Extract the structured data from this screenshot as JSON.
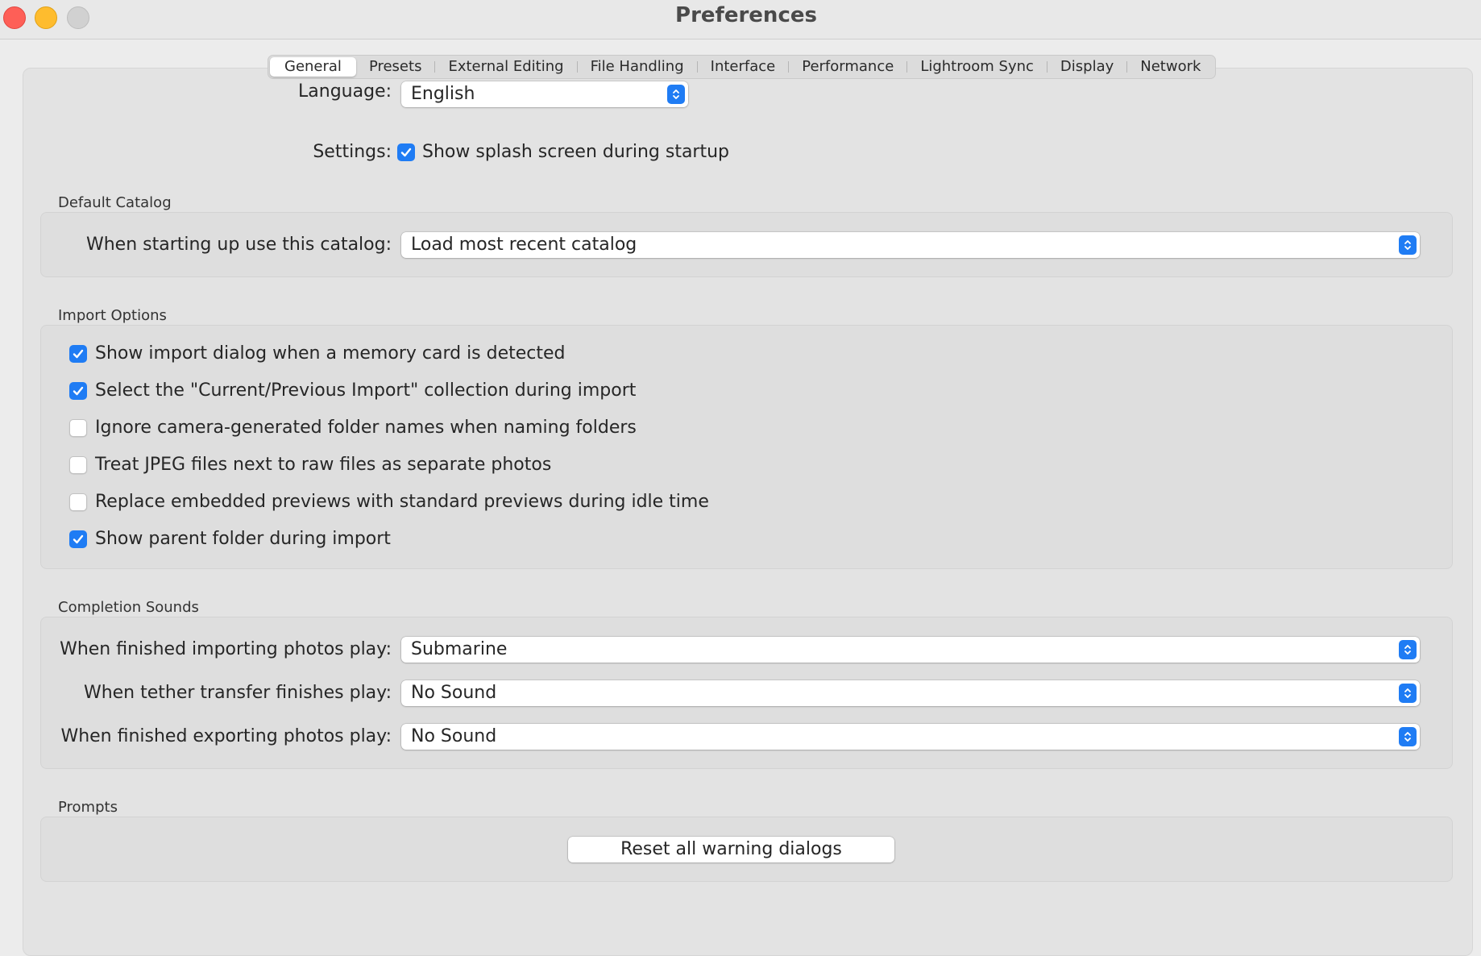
{
  "window": {
    "title": "Preferences"
  },
  "tabs": [
    {
      "label": "General",
      "active": true
    },
    {
      "label": "Presets"
    },
    {
      "label": "External Editing"
    },
    {
      "label": "File Handling"
    },
    {
      "label": "Interface"
    },
    {
      "label": "Performance"
    },
    {
      "label": "Lightroom Sync"
    },
    {
      "label": "Display"
    },
    {
      "label": "Network"
    }
  ],
  "general": {
    "language_label": "Language:",
    "language_value": "English",
    "settings_label": "Settings:",
    "splash_label": "Show splash screen during startup",
    "splash_checked": true
  },
  "default_catalog": {
    "title": "Default Catalog",
    "label": "When starting up use this catalog:",
    "value": "Load most recent catalog"
  },
  "import_options": {
    "title": "Import Options",
    "items": [
      {
        "label": "Show import dialog when a memory card is detected",
        "checked": true
      },
      {
        "label": "Select the \"Current/Previous Import\" collection during import",
        "checked": true
      },
      {
        "label": "Ignore camera-generated folder names when naming folders",
        "checked": false
      },
      {
        "label": "Treat JPEG files next to raw files as separate photos",
        "checked": false
      },
      {
        "label": "Replace embedded previews with standard previews during idle time",
        "checked": false
      },
      {
        "label": "Show parent folder during import",
        "checked": true
      }
    ]
  },
  "completion_sounds": {
    "title": "Completion Sounds",
    "rows": [
      {
        "label": "When finished importing photos play:",
        "value": "Submarine"
      },
      {
        "label": "When tether transfer finishes play:",
        "value": "No Sound"
      },
      {
        "label": "When finished exporting photos play:",
        "value": "No Sound"
      }
    ]
  },
  "prompts": {
    "title": "Prompts",
    "reset_label": "Reset all warning dialogs"
  },
  "colors": {
    "accent": "#1f7cf4",
    "close": "#fe5f57",
    "minimize": "#febc2e",
    "zoom_disabled": "#d1d1d1"
  }
}
